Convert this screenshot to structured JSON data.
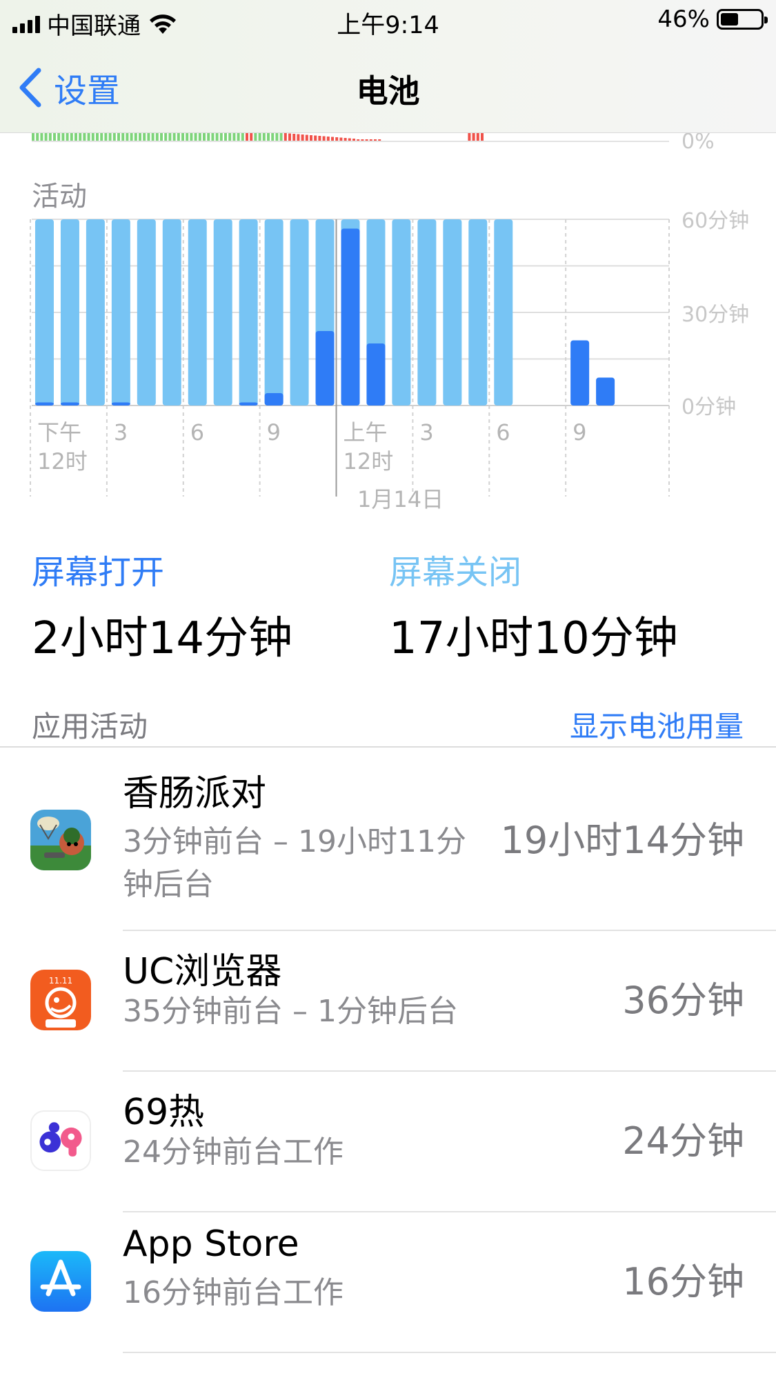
{
  "status_bar": {
    "carrier": "中国联通",
    "time": "上午9:14",
    "battery_percent": "46%",
    "battery_level": 0.46
  },
  "nav": {
    "back_label": "设置",
    "title": "电池"
  },
  "battery_strip": {
    "y_tick": "0%",
    "colors": {
      "charging": "#7ed47a",
      "low": "#f0524a"
    }
  },
  "chart_data": {
    "type": "bar",
    "title": "活动",
    "y_ticks": [
      "60分钟",
      "30分钟",
      "0分钟"
    ],
    "ylim": [
      0,
      60
    ],
    "x_tick_labels": [
      {
        "line1": "下午",
        "line2": "12时"
      },
      {
        "line1": "3",
        "line2": ""
      },
      {
        "line1": "6",
        "line2": ""
      },
      {
        "line1": "9",
        "line2": ""
      },
      {
        "line1": "上午",
        "line2": "12时"
      },
      {
        "line1": "3",
        "line2": ""
      },
      {
        "line1": "6",
        "line2": ""
      },
      {
        "line1": "9",
        "line2": ""
      }
    ],
    "date_label": "1月14日",
    "series": [
      {
        "name": "屏幕关闭",
        "color": "#77c4f4",
        "values": [
          60,
          60,
          60,
          60,
          60,
          60,
          60,
          60,
          60,
          60,
          60,
          60,
          60,
          60,
          60,
          60,
          60,
          60,
          60,
          0,
          0,
          0,
          0,
          0,
          0
        ]
      },
      {
        "name": "屏幕打开",
        "color": "#2f7cf6",
        "values": [
          1,
          1,
          0,
          1,
          0,
          0,
          0,
          0,
          1,
          4,
          0,
          24,
          57,
          20,
          0,
          0,
          0,
          0,
          0,
          0,
          0,
          21,
          9,
          0,
          0
        ]
      }
    ]
  },
  "screen_summary": {
    "on": {
      "label": "屏幕打开",
      "value": "2小时14分钟",
      "color": "#2f7cf6"
    },
    "off": {
      "label": "屏幕关闭",
      "value": "17小时10分钟",
      "color": "#77c4f4"
    }
  },
  "activity": {
    "header": "应用活动",
    "toggle_label": "显示电池用量",
    "apps": [
      {
        "name": "香肠派对",
        "sub": "3分钟前台 – 19小时11分钟后台",
        "time": "19小时14分钟",
        "icon": "game-icon"
      },
      {
        "name": "UC浏览器",
        "sub": "35分钟前台 – 1分钟后台",
        "time": "36分钟",
        "icon": "uc-browser-icon"
      },
      {
        "name": "69热",
        "sub": "24分钟前台工作",
        "time": "24分钟",
        "icon": "69re-icon"
      },
      {
        "name": "App Store",
        "sub": "16分钟前台工作",
        "time": "16分钟",
        "icon": "app-store-icon"
      }
    ]
  }
}
